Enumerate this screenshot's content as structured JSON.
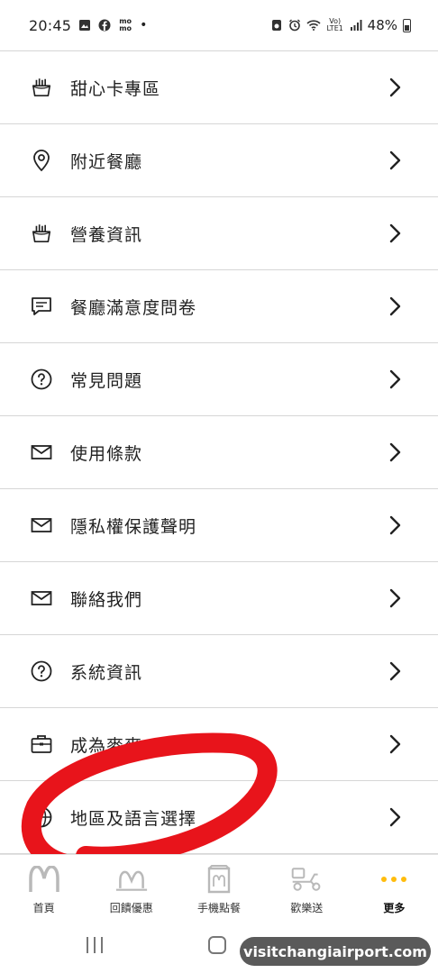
{
  "status_bar": {
    "time": "20:45",
    "left_icons": [
      "image-icon",
      "facebook-icon",
      "momo-icon"
    ],
    "momo_text": "mo mo",
    "lte_text": "Vo) LTE1",
    "battery": "48%"
  },
  "menu": {
    "items": [
      {
        "label": "甜心卡專區",
        "icon": "fries-icon"
      },
      {
        "label": "附近餐廳",
        "icon": "location-pin-icon"
      },
      {
        "label": "營養資訊",
        "icon": "fries-icon"
      },
      {
        "label": "餐廳滿意度問卷",
        "icon": "chat-icon"
      },
      {
        "label": "常見問題",
        "icon": "question-icon"
      },
      {
        "label": "使用條款",
        "icon": "envelope-icon"
      },
      {
        "label": "隱私權保護聲明",
        "icon": "envelope-icon"
      },
      {
        "label": "聯絡我們",
        "icon": "envelope-icon"
      },
      {
        "label": "系統資訊",
        "icon": "question-icon"
      },
      {
        "label": "成為麥麥",
        "icon": "briefcase-icon"
      },
      {
        "label": "地區及語言選擇",
        "icon": "globe-icon"
      }
    ]
  },
  "bottom_nav": {
    "items": [
      {
        "label": "首頁",
        "icon": "mcdonalds-arches-icon"
      },
      {
        "label": "回饋優惠",
        "icon": "rewards-arches-icon"
      },
      {
        "label": "手機點餐",
        "icon": "bag-icon"
      },
      {
        "label": "歡樂送",
        "icon": "delivery-scooter-icon"
      },
      {
        "label": "更多",
        "icon": "more-dots-icon",
        "active": true
      }
    ]
  },
  "watermark": "visitchangiairport.com",
  "colors": {
    "accent": "#ffbc0d",
    "scribble": "#e8141b"
  }
}
